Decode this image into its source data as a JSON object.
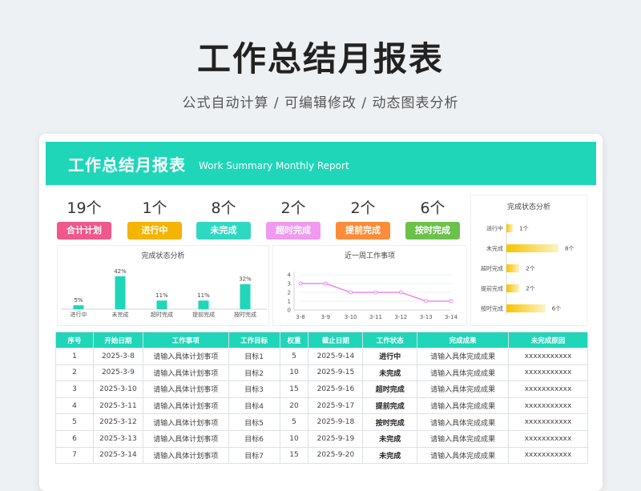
{
  "page": {
    "title": "工作总结月报表",
    "subtitle": "公式自动计算 / 可编辑修改 / 动态图表分析"
  },
  "banner": {
    "title": "工作总结月报表",
    "subtitle": "Work Summary Monthly Report",
    "color": "#1fd6b9"
  },
  "stats": [
    {
      "count": "19个",
      "label": "合计计划",
      "color": "#f0578a"
    },
    {
      "count": "1个",
      "label": "进行中",
      "color": "#f5b400"
    },
    {
      "count": "8个",
      "label": "未完成",
      "color": "#2fd8c2"
    },
    {
      "count": "2个",
      "label": "超时完成",
      "color": "#f199f0"
    },
    {
      "count": "2个",
      "label": "提前完成",
      "color": "#fb8c3a"
    },
    {
      "count": "6个",
      "label": "按时完成",
      "color": "#6cc14b"
    }
  ],
  "chart_data": [
    {
      "type": "bar",
      "title": "完成状态分析",
      "categories": [
        "进行中",
        "未完成",
        "超时完成",
        "提前完成",
        "按时完成"
      ],
      "values": [
        5,
        42,
        11,
        11,
        32
      ],
      "value_labels": [
        "5%",
        "42%",
        "11%",
        "11%",
        "32%"
      ],
      "color": "#1fd6b9"
    },
    {
      "type": "line",
      "title": "近一周工作事项",
      "categories": [
        "3-8",
        "3-9",
        "3-10",
        "3-11",
        "3-12",
        "3-13",
        "3-14"
      ],
      "values": [
        3,
        3,
        2,
        2,
        2,
        1,
        1
      ],
      "ylim": [
        0,
        4
      ],
      "yticks": [
        "0",
        "1",
        "2",
        "3",
        "4"
      ],
      "color": "#ee88ee"
    },
    {
      "type": "bar",
      "orientation": "horizontal",
      "title": "完成状态分析",
      "categories": [
        "进行中",
        "未完成",
        "超时完成",
        "提前完成",
        "按时完成"
      ],
      "values": [
        1,
        8,
        2,
        2,
        6
      ],
      "value_labels": [
        "1个",
        "8个",
        "2个",
        "2个",
        "6个"
      ],
      "color": "#f5c400"
    }
  ],
  "table": {
    "headers": [
      "序号",
      "开始日期",
      "工作事项",
      "工作目标",
      "权重",
      "截止日期",
      "工作状态",
      "完成成果",
      "未完成原因"
    ],
    "rows": [
      [
        "1",
        "2025-3-8",
        "请输入具体计划事项",
        "目标1",
        "5",
        "2025-9-14",
        "进行中",
        "请输入具体完成成果",
        "xxxxxxxxxxx"
      ],
      [
        "2",
        "2025-3-9",
        "请输入具体计划事项",
        "目标2",
        "10",
        "2025-9-15",
        "未完成",
        "请输入具体完成成果",
        "xxxxxxxxxxx"
      ],
      [
        "3",
        "2025-3-10",
        "请输入具体计划事项",
        "目标3",
        "15",
        "2025-9-16",
        "超时完成",
        "请输入具体完成成果",
        "xxxxxxxxxxx"
      ],
      [
        "4",
        "2025-3-11",
        "请输入具体计划事项",
        "目标4",
        "20",
        "2025-9-17",
        "提前完成",
        "请输入具体完成成果",
        "xxxxxxxxxxx"
      ],
      [
        "5",
        "2025-3-12",
        "请输入具体计划事项",
        "目标5",
        "5",
        "2025-9-18",
        "按时完成",
        "请输入具体完成成果",
        "xxxxxxxxxxx"
      ],
      [
        "6",
        "2025-3-13",
        "请输入具体计划事项",
        "目标6",
        "10",
        "2025-9-19",
        "未完成",
        "请输入具体完成成果",
        "xxxxxxxxxxx"
      ],
      [
        "7",
        "2025-3-14",
        "请输入具体计划事项",
        "目标7",
        "15",
        "2025-9-20",
        "未完成",
        "请输入具体完成成果",
        "xxxxxxxxxxx"
      ]
    ]
  }
}
